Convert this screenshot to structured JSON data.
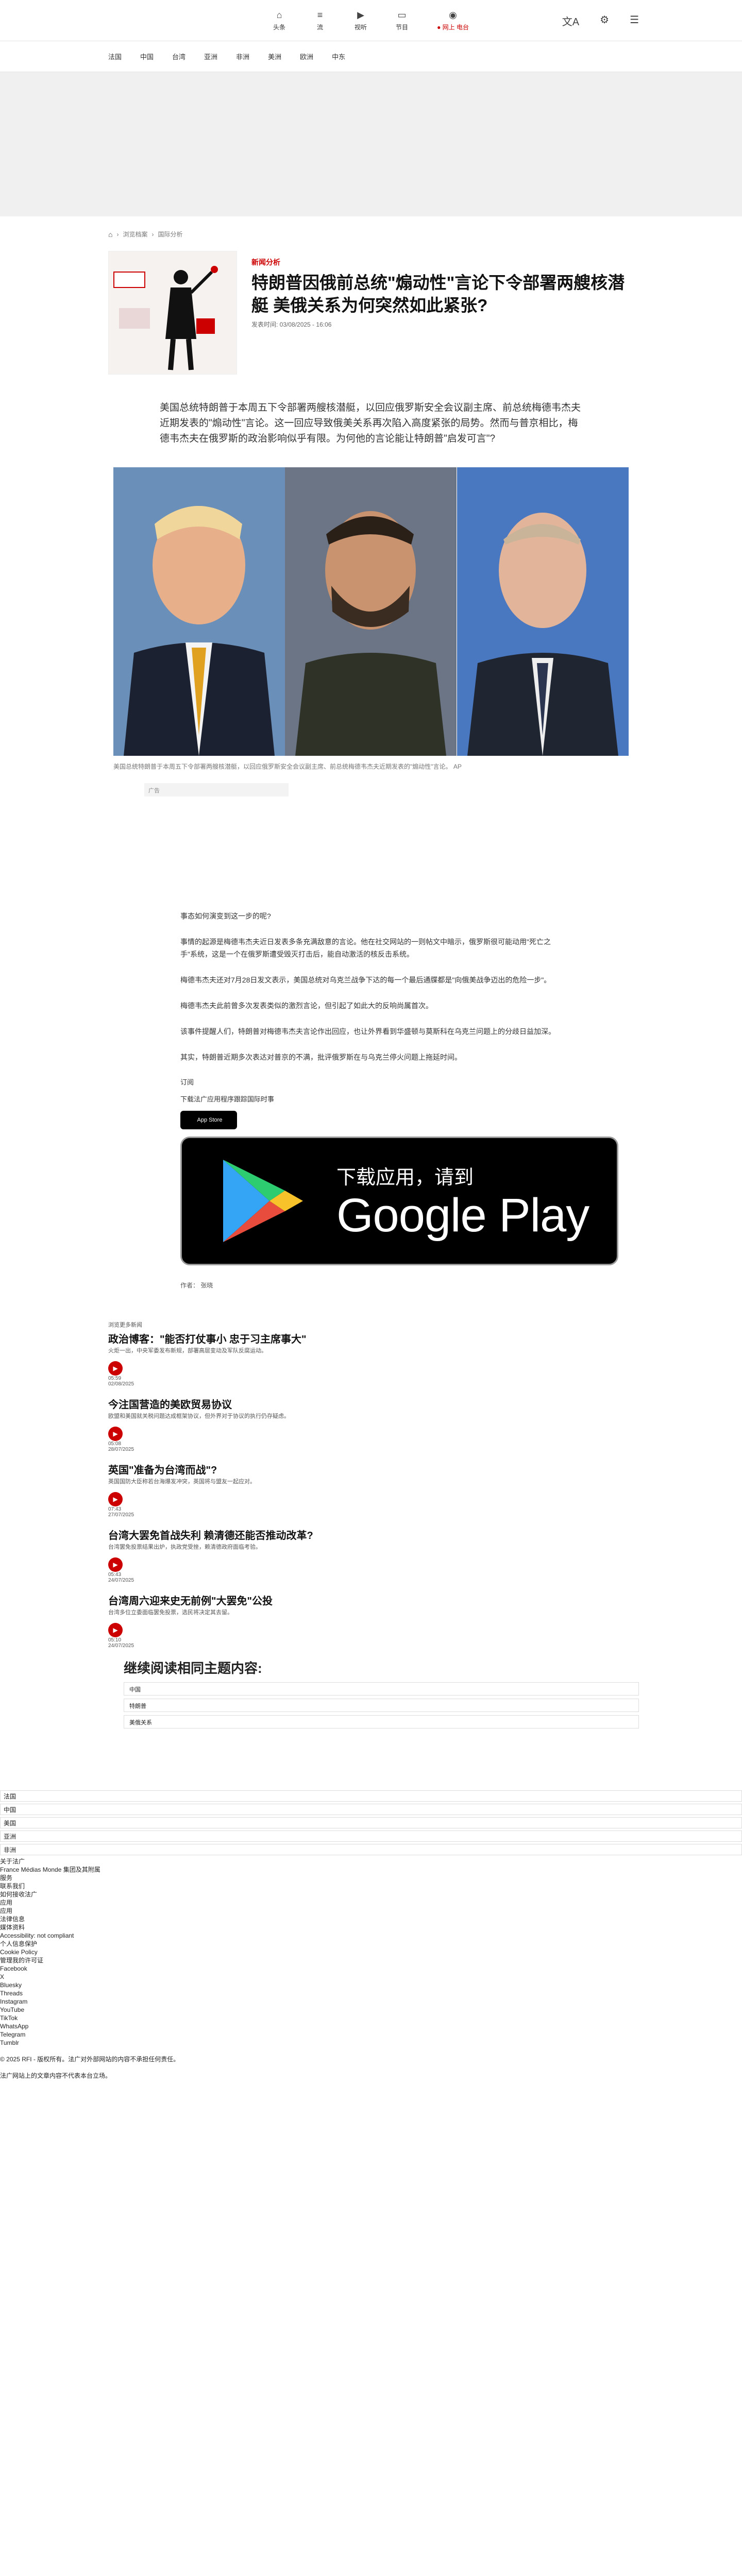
{
  "topnav": [
    {
      "label": "头条",
      "icon": "home-icon",
      "glyph": "⌂"
    },
    {
      "label": "流",
      "icon": "feed-icon",
      "glyph": "≡"
    },
    {
      "label": "视听",
      "icon": "video-icon",
      "glyph": "▶"
    },
    {
      "label": "节目",
      "icon": "tv-icon",
      "glyph": "▭"
    },
    {
      "label": "● 网上 电台",
      "icon": "radio-icon",
      "glyph": "◉"
    }
  ],
  "secnav": [
    "法国",
    "中国",
    "台湾",
    "亚洲",
    "非洲",
    "美洲",
    "欧洲",
    "中东"
  ],
  "breadcrumb": [
    "浏览档案",
    "国际分析"
  ],
  "article": {
    "kicker": "新闻分析",
    "title": "特朗普因俄前总统\"煽动性\"言论下令部署两艘核潜艇 美俄关系为何突然如此紧张?",
    "date": "发表时间: 03/08/2025 - 16:06",
    "lead": "美国总统特朗普于本周五下令部署两艘核潜艇，以回应俄罗斯安全会议副主席、前总统梅德韦杰夫近期发表的\"煽动性\"言论。这一回应导致俄美关系再次陷入高度紧张的局势。然而与普京相比，梅德韦杰夫在俄罗斯的政治影响似乎有限。为何他的言论能让特朗普\"启发可言\"?",
    "caption": "美国总统特朗普于本周五下令部署两艘核潜艇，以回应俄罗斯安全会议副主席、前总统梅德韦杰夫近期发表的\"煽动性\"言论。 AP",
    "ad_label": "广告",
    "body": [
      "事态如何演变到这一步的呢?",
      "事情的起源是梅德韦杰夫近日发表多条充满敌意的言论。他在社交网站的一则帖文中暗示，俄罗斯很可能动用\"死亡之手\"系统，这是一个在俄罗斯遭受毁灭打击后，能自动激活的核反击系统。",
      "梅德韦杰夫还对7月28日发文表示，美国总统对乌克兰战争下达的每一个最后通牒都是\"向俄美战争迈出的危险一步\"。",
      "梅德韦杰夫此前曾多次发表类似的激烈言论，但引起了如此大的反响尚属首次。",
      "该事件提醒人们，特朗普对梅德韦杰夫言论作出回应，也让外界看到华盛顿与莫斯科在乌克兰问题上的分歧日益加深。",
      "其实，特朗普近期多次表达对普京的不满，批评俄罗斯在与乌克兰停火问题上拖延时间。"
    ],
    "app": {
      "note": "订阅",
      "download_text": "下载法广应用程序跟踪国际时事",
      "appstore_label": "App Store",
      "googleplay_small": "下载应用，请到",
      "googleplay_big": "Google Play"
    },
    "author": "作者：  张晓"
  },
  "related_label": "浏览更多新闻",
  "related": [
    {
      "head": "浏览更多",
      "title": "政治博客：\"能否打仗事小 忠于习主席事大\"",
      "desc": "火炬一出，中央军委发布新规，部署高层变动及军队反腐运动。",
      "time": "05:59",
      "date": "02/08/2025"
    },
    {
      "head": "",
      "title": "今注国营造的美欧贸易协议",
      "desc": "欧盟和美国就关税问题达成框架协议，但外界对于协议的执行仍存疑虑。",
      "time": "05:08",
      "date": "28/07/2025"
    },
    {
      "head": "",
      "title": "英国\"准备为台湾而战\"?",
      "desc": "英国国防大臣称若台海爆发冲突，英国将与盟友一起应对。",
      "time": "07:43",
      "date": "27/07/2025"
    },
    {
      "head": "",
      "title": "台湾大罢免首战失利 赖清德还能否推动改革?",
      "desc": "台湾罢免投票结果出炉，执政党受挫，赖清德政府面临考验。",
      "time": "05:43",
      "date": "24/07/2025"
    },
    {
      "head": "",
      "title": "台湾周六迎来史无前例\"大罢免\"公投",
      "desc": "台湾多位立委面临罢免投票，选民将决定其去留。",
      "time": "05:10",
      "date": "24/07/2025"
    }
  ],
  "topics_title": "继续阅读相同主题内容:",
  "topics": [
    "中国",
    "特朗普",
    "美俄关系"
  ],
  "footer": {
    "items": [
      "法国",
      "中国",
      "美国",
      "亚洲",
      "非洲",
      "关于法广",
      "France Médias Monde 集团及其附属",
      "服务",
      "联系我们",
      "如何接收法广",
      "应用",
      "应用",
      "法律信息",
      "媒体资料",
      "Accessibility: not compliant",
      "个人信息保护",
      "Cookie Policy",
      "管理我的许可证",
      "Facebook",
      "X",
      "Bluesky",
      "Threads",
      "Instagram",
      "YouTube",
      "TikTok",
      "WhatsApp",
      "Telegram",
      "Tumblr"
    ],
    "copyright": "© 2025 RFI - 版权所有。法广对外部网站的内容不承担任何责任。",
    "closing": "法广网站上的文章内容不代表本台立场。"
  }
}
